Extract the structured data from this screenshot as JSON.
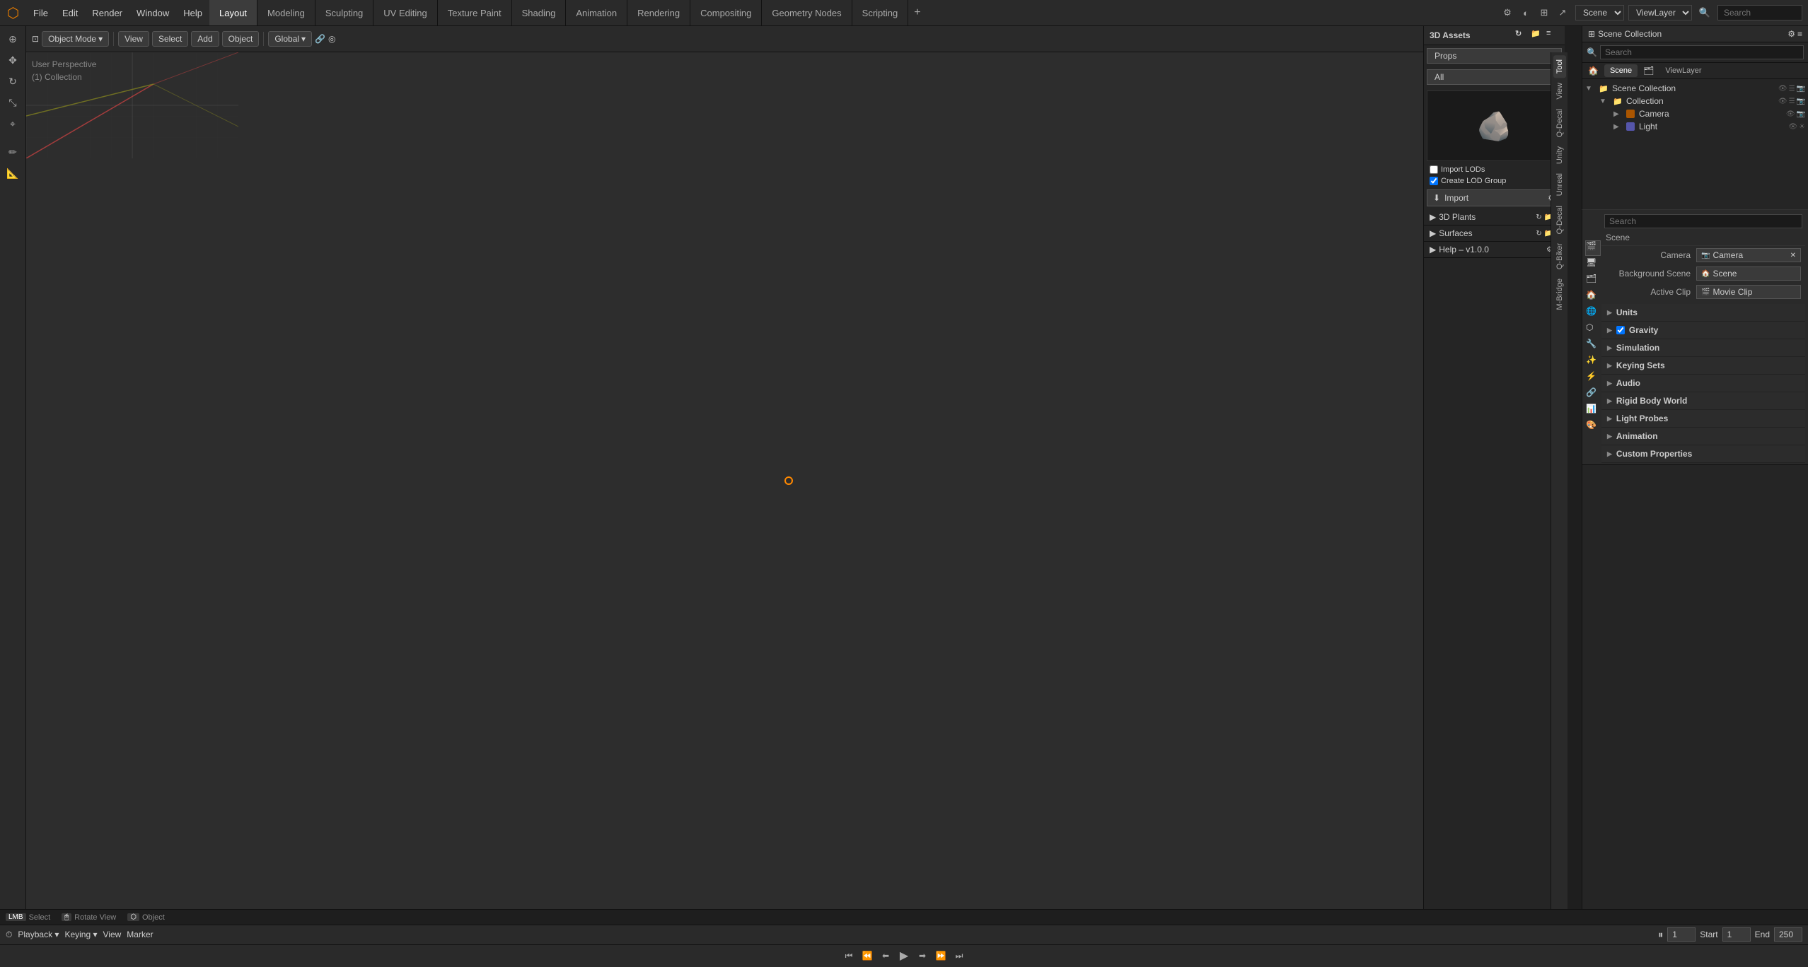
{
  "app": {
    "title": "Blender"
  },
  "menubar": {
    "logo": "●",
    "file_menus": [
      "File",
      "Edit",
      "Render",
      "Window",
      "Help"
    ],
    "workspace_tabs": [
      {
        "label": "Layout",
        "active": true
      },
      {
        "label": "Modeling",
        "active": false
      },
      {
        "label": "Sculpting",
        "active": false
      },
      {
        "label": "UV Editing",
        "active": false
      },
      {
        "label": "Texture Paint",
        "active": false
      },
      {
        "label": "Shading",
        "active": false
      },
      {
        "label": "Animation",
        "active": false
      },
      {
        "label": "Rendering",
        "active": false
      },
      {
        "label": "Compositing",
        "active": false
      },
      {
        "label": "Geometry Nodes",
        "active": false
      },
      {
        "label": "Scripting",
        "active": false
      }
    ],
    "add_tab": "+",
    "scene": "Scene",
    "viewlayer": "ViewLayer",
    "search_placeholder": "Search"
  },
  "viewport_header": {
    "object_mode": "Object Mode",
    "view": "View",
    "select": "Select",
    "add": "Add",
    "object": "Object",
    "transform": "Global",
    "snap": "Snap"
  },
  "viewport": {
    "label_line1": "User Perspective",
    "label_line2": "(1) Collection"
  },
  "assets_panel": {
    "title": "3D Assets",
    "category": "Props",
    "filter": "All",
    "import_lods_label": "Import LODs",
    "create_lod_group_label": "Create LOD Group",
    "import_btn": "Import",
    "subcategories": [
      {
        "label": "3D Plants"
      },
      {
        "label": "Surfaces"
      },
      {
        "label": "Help – v1.0.0"
      }
    ]
  },
  "n_panel_tabs": [
    {
      "label": "Tool",
      "active": false
    },
    {
      "label": "View",
      "active": false
    },
    {
      "label": "Q-Decal",
      "active": false
    },
    {
      "label": "Unity",
      "active": false
    },
    {
      "label": "Unreal",
      "active": false
    },
    {
      "label": "Q-Decal",
      "active": false
    },
    {
      "label": "Q-Biker",
      "active": false
    },
    {
      "label": "M-Bridge",
      "active": false
    }
  ],
  "outliner": {
    "title": "Scene Collection",
    "search_placeholder": "Search",
    "tabs": [
      "Scene",
      "ViewLayer"
    ],
    "tree": [
      {
        "label": "Scene Collection",
        "icon": "📁",
        "level": 0,
        "expanded": true,
        "actions": [
          "eye",
          "filter",
          "camera"
        ]
      },
      {
        "label": "Collection",
        "icon": "📁",
        "level": 1,
        "expanded": true,
        "actions": [
          "eye",
          "filter",
          "camera"
        ]
      },
      {
        "label": "Camera",
        "icon": "📷",
        "level": 2,
        "expanded": false,
        "actions": [
          "eye",
          "camera"
        ]
      },
      {
        "label": "Light",
        "icon": "💡",
        "level": 2,
        "expanded": false,
        "actions": [
          "eye",
          "camera"
        ]
      }
    ]
  },
  "properties": {
    "panel_tabs": [
      "scene",
      "world",
      "object",
      "modifier",
      "particles",
      "physics",
      "constraints",
      "data"
    ],
    "scene_label": "Scene",
    "camera_label": "Camera",
    "camera_value": "Camera",
    "background_scene_label": "Background Scene",
    "scene_value": "Scene",
    "active_clip_label": "Active Clip",
    "movie_clip_value": "Movie Clip",
    "sections": [
      {
        "label": "Units",
        "expanded": false
      },
      {
        "label": "Gravity",
        "expanded": false,
        "has_check": true,
        "checked": true
      },
      {
        "label": "Simulation",
        "expanded": false
      },
      {
        "label": "Keying Sets",
        "expanded": false
      },
      {
        "label": "Audio",
        "expanded": false
      },
      {
        "label": "Rigid Body World",
        "expanded": false
      },
      {
        "label": "Light Probes",
        "expanded": false
      },
      {
        "label": "Animation",
        "expanded": false
      },
      {
        "label": "Custom Properties",
        "expanded": false
      }
    ]
  },
  "timeline": {
    "playback": "Playback",
    "keying": "Keying",
    "view": "View",
    "marker": "Marker",
    "frame_current": "1",
    "start_label": "Start",
    "start_value": "1",
    "end_label": "End",
    "end_value": "250"
  },
  "status_bar": {
    "select": "Select",
    "rotate_view": "Rotate View",
    "object": "Object"
  }
}
